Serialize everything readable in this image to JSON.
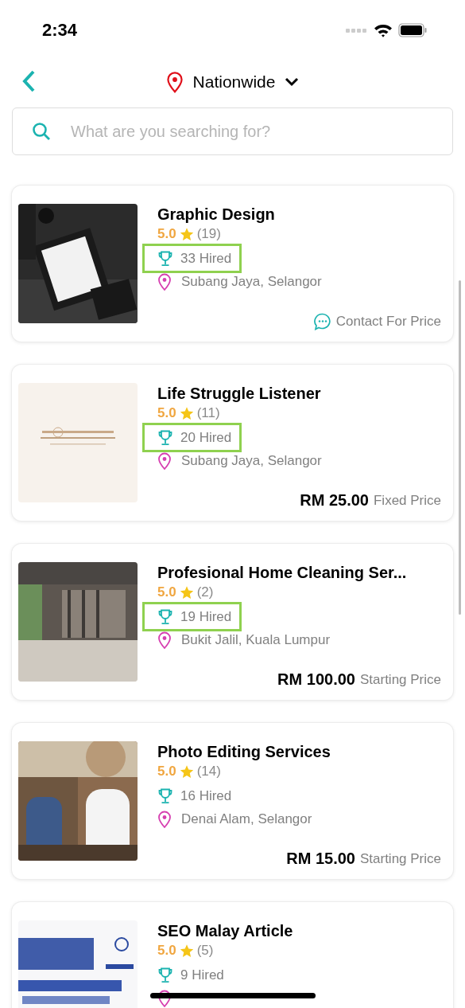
{
  "status_bar": {
    "time": "2:34"
  },
  "header": {
    "location": "Nationwide"
  },
  "search": {
    "placeholder": "What are you searching for?"
  },
  "services": [
    {
      "title": "Graphic Design",
      "rating": "5.0",
      "reviews": "(19)",
      "hired": "33 Hired",
      "highlighted": true,
      "location": "Subang Jaya, Selangor",
      "price": {
        "kind": "contact",
        "label": "Contact For Price"
      }
    },
    {
      "title": "Life Struggle Listener",
      "rating": "5.0",
      "reviews": "(11)",
      "hired": "20 Hired",
      "highlighted": true,
      "location": "Subang Jaya, Selangor",
      "price": {
        "kind": "amount",
        "amount": "RM 25.00",
        "label": "Fixed Price"
      }
    },
    {
      "title": "Profesional Home Cleaning Ser...",
      "rating": "5.0",
      "reviews": "(2)",
      "hired": "19 Hired",
      "highlighted": true,
      "location": "Bukit Jalil, Kuala Lumpur",
      "price": {
        "kind": "amount",
        "amount": "RM 100.00",
        "label": "Starting Price"
      }
    },
    {
      "title": "Photo Editing Services",
      "rating": "5.0",
      "reviews": "(14)",
      "hired": "16 Hired",
      "highlighted": false,
      "location": "Denai Alam, Selangor",
      "price": {
        "kind": "amount",
        "amount": "RM 15.00",
        "label": "Starting Price"
      }
    },
    {
      "title": "SEO Malay Article",
      "rating": "5.0",
      "reviews": "(5)",
      "hired": "9 Hired",
      "highlighted": false
    }
  ]
}
